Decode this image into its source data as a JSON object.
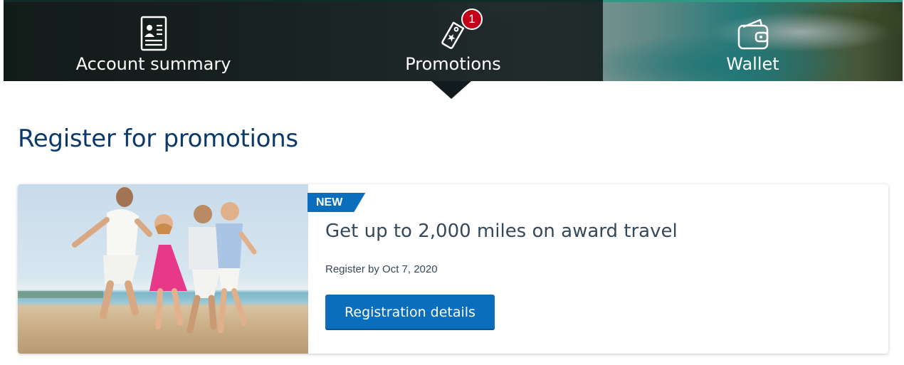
{
  "nav": {
    "items": [
      {
        "label": "Account summary",
        "icon": "id-card-icon"
      },
      {
        "label": "Promotions",
        "icon": "tag-icon",
        "badge": "1"
      },
      {
        "label": "Wallet",
        "icon": "wallet-icon"
      }
    ],
    "active": "Promotions"
  },
  "page": {
    "title": "Register for promotions"
  },
  "promo_card": {
    "tag": "NEW",
    "title": "Get up to 2,000 miles on award travel",
    "deadline": "Register by Oct 7, 2020",
    "cta_label": "Registration details",
    "image": "family-running-on-beach-photo"
  },
  "colors": {
    "accent_blue": "#0b6ebd",
    "heading_navy": "#0b3a6a",
    "badge_red": "#c30019",
    "text_slate": "#36495a"
  }
}
